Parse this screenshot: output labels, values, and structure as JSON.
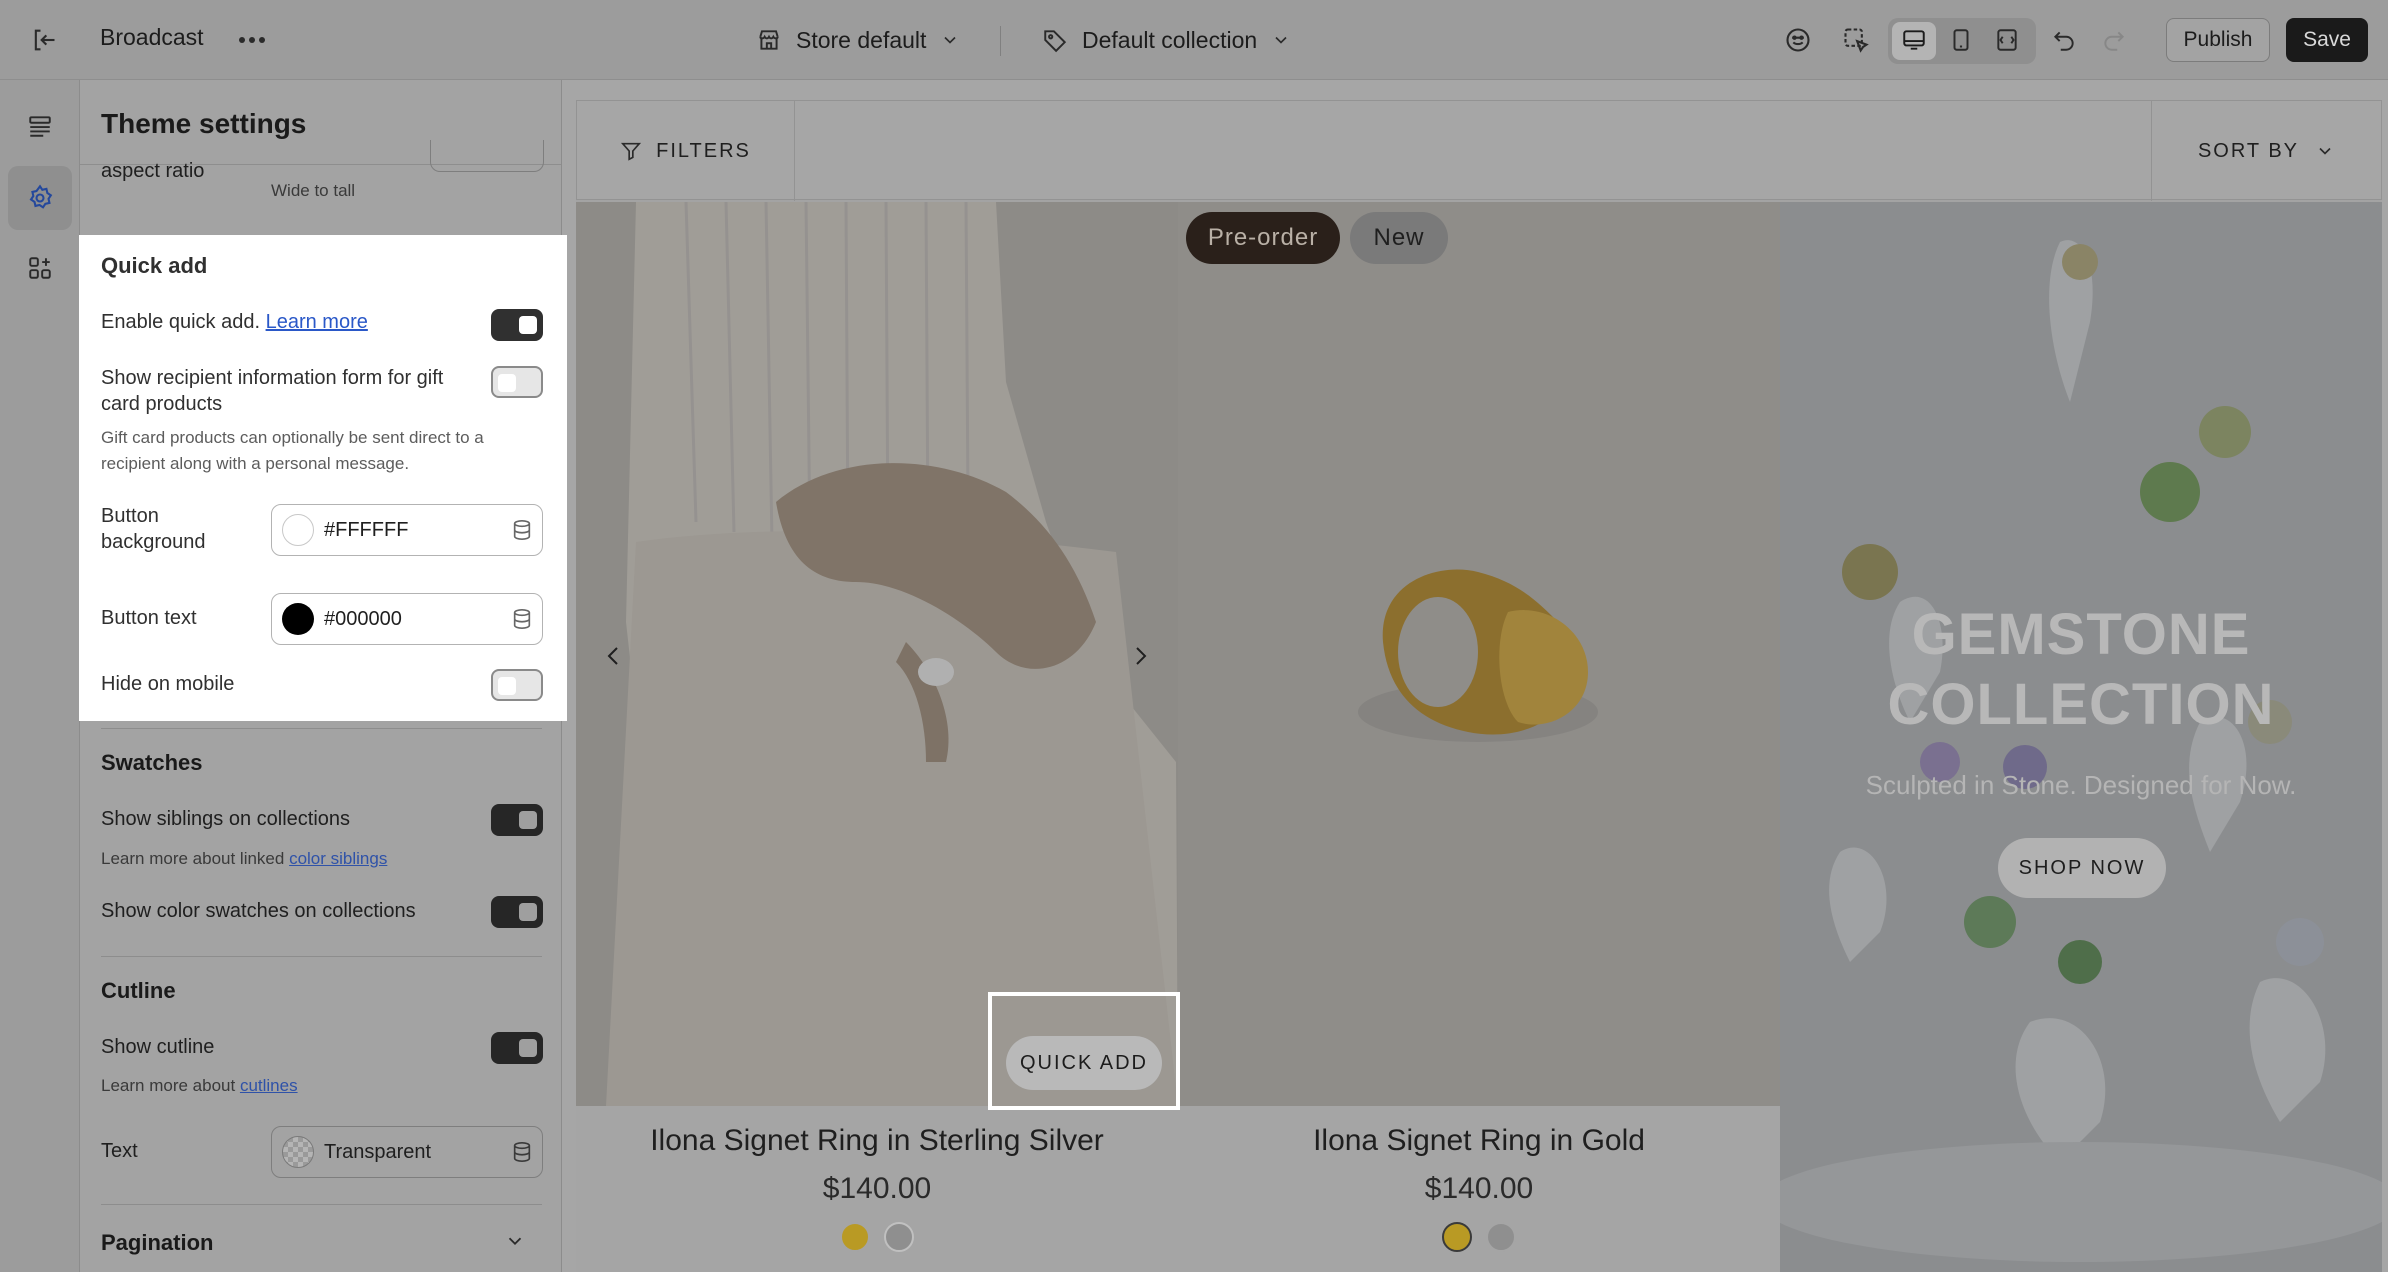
{
  "topbar": {
    "title": "Broadcast",
    "store_label": "Store default",
    "collection_label": "Default collection",
    "publish_label": "Publish",
    "save_label": "Save"
  },
  "panel": {
    "title": "Theme settings",
    "aspect": {
      "label": "aspect ratio",
      "sub": "Wide to tall"
    },
    "quick_add": {
      "heading": "Quick add",
      "enable_label": "Enable quick add.",
      "enable_link": "Learn more",
      "enable_on": true,
      "gift_label": "Show recipient information form for gift card products",
      "gift_on": false,
      "gift_help": "Gift card products can optionally be sent direct to a recipient along with a personal message.",
      "btn_bg_label": "Button background",
      "btn_bg_value": "#FFFFFF",
      "btn_text_label": "Button text",
      "btn_text_value": "#000000",
      "hide_mobile_label": "Hide on mobile",
      "hide_mobile_on": false
    },
    "swatches": {
      "heading": "Swatches",
      "siblings_label": "Show siblings on collections",
      "siblings_on": true,
      "siblings_help_prefix": "Learn more about linked",
      "siblings_help_link": "color siblings",
      "color_label": "Show color swatches on collections",
      "color_on": true
    },
    "cutline": {
      "heading": "Cutline",
      "show_label": "Show cutline",
      "show_on": true,
      "help_prefix": "Learn more about",
      "help_link": "cutlines",
      "text_label": "Text",
      "text_value": "Transparent"
    },
    "pagination": {
      "heading": "Pagination"
    }
  },
  "preview": {
    "filters_label": "FILTERS",
    "sort_label": "SORT BY",
    "badges": [
      "Pre-order",
      "New"
    ],
    "quick_add_label": "QUICK ADD",
    "products": [
      {
        "name": "Ilona Signet Ring in Sterling Silver",
        "price": "$140.00",
        "swatches": [
          "#c9a227",
          "#a9a9a9"
        ]
      },
      {
        "name": "Ilona Signet Ring in Gold",
        "price": "$140.00",
        "swatches": [
          "#c9a227",
          "#a9a9a9"
        ]
      }
    ],
    "promo": {
      "title_line1": "GEMSTONE",
      "title_line2": "COLLECTION",
      "subtitle": "Sculpted in Stone. Designed for Now.",
      "button": "SHOP NOW"
    }
  }
}
